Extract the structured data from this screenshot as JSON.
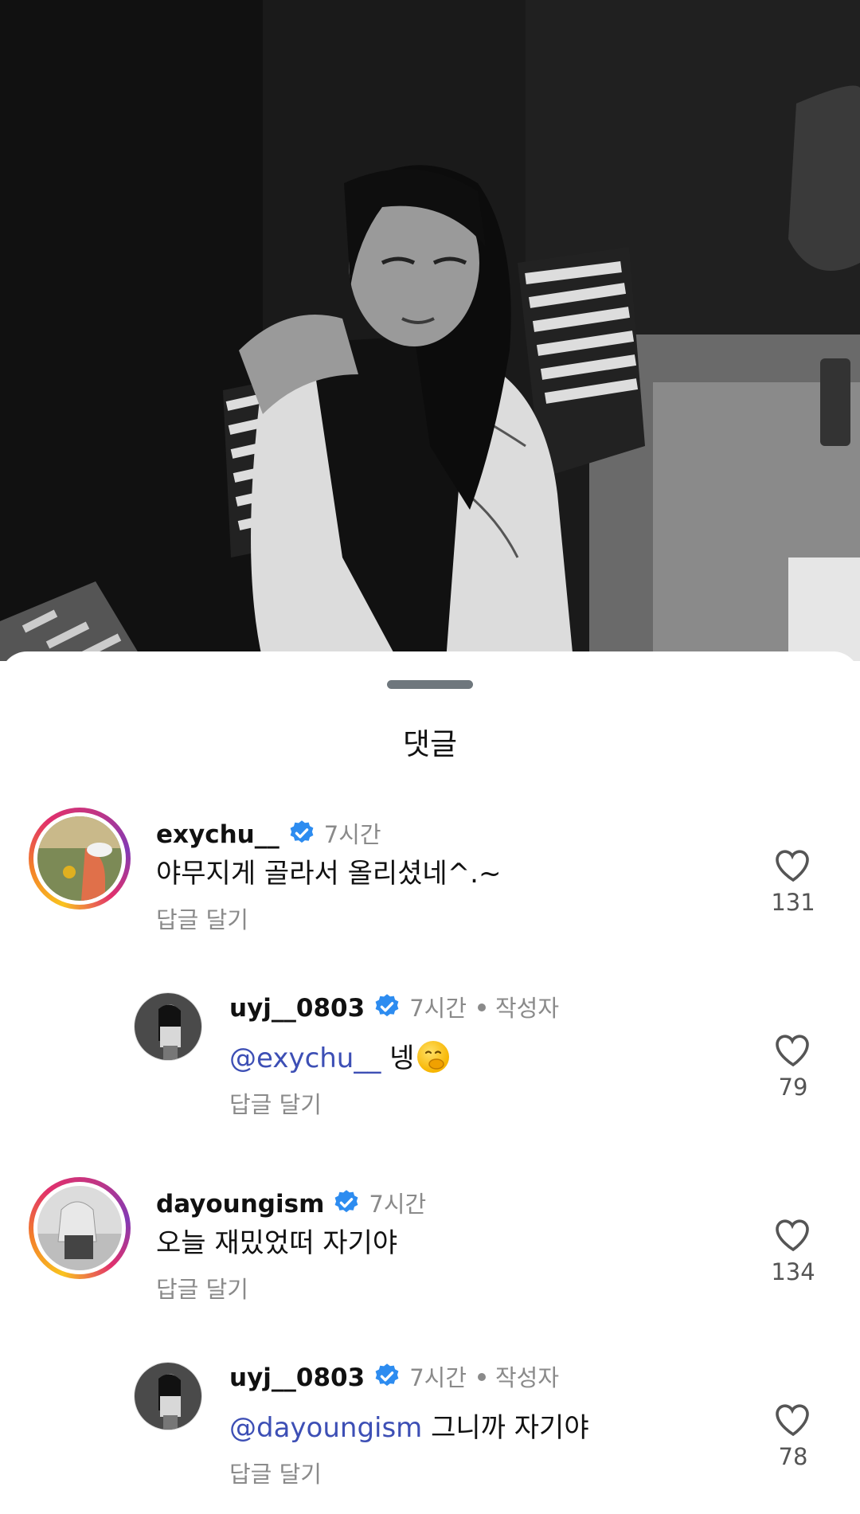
{
  "sheet": {
    "title": "댓글"
  },
  "comments": [
    {
      "username": "exychu__",
      "time": "7시간",
      "author_tag": "",
      "mention": "",
      "text": "야무지게 골라서 올리셨네^.~",
      "reply_label": "답글 달기",
      "likes": "131",
      "is_reply": false
    },
    {
      "username": "uyj__0803",
      "time": "7시간",
      "author_tag": "작성자",
      "mention": "@exychu__",
      "text": " 넹",
      "reply_label": "답글 달기",
      "likes": "79",
      "is_reply": true
    },
    {
      "username": "dayoungism",
      "time": "7시간",
      "author_tag": "",
      "mention": "",
      "text": "오늘 재밌었떠 자기야",
      "reply_label": "답글 달기",
      "likes": "134",
      "is_reply": false
    },
    {
      "username": "uyj__0803",
      "time": "7시간",
      "author_tag": "작성자",
      "mention": "@dayoungism",
      "text": " 그니까 자기야",
      "reply_label": "답글 달기",
      "likes": "78",
      "is_reply": true
    }
  ],
  "colors": {
    "verified": "#2d8cf0",
    "mention": "#3d4fb5",
    "muted": "#8a8a8a"
  },
  "icons": {
    "verified": "verified-badge-icon",
    "like": "heart-outline-icon",
    "emoji": "face-with-hand-over-mouth"
  }
}
